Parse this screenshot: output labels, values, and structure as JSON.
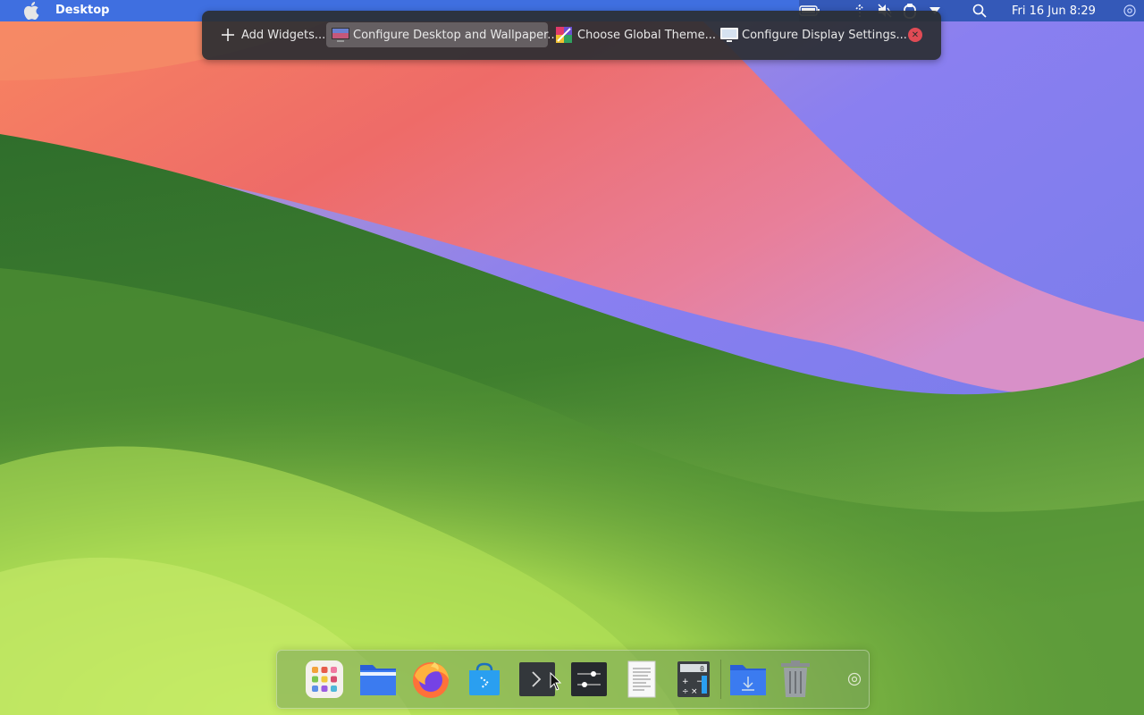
{
  "menubar": {
    "app_name": "Desktop",
    "clock": "Fri 16 Jun 8:29",
    "tray_icons": [
      "battery-icon",
      "network-icon",
      "volume-muted-icon",
      "clipboard-icon",
      "expand-arrow-icon",
      "search-icon",
      "settings-icon"
    ]
  },
  "toolbar": {
    "add_widgets": "Add Widgets...",
    "configure_desktop": "Configure Desktop and Wallpaper...",
    "global_theme": "Choose Global Theme...",
    "display_settings": "Configure Display Settings..."
  },
  "dock": {
    "items": [
      "launchpad",
      "file-manager",
      "firefox",
      "discover-store",
      "terminal",
      "system-settings",
      "text-editor",
      "calculator",
      "downloads",
      "trash",
      "dock-settings"
    ]
  },
  "colors": {
    "menubar": "#3f6fe0",
    "tray": "#3459b8",
    "toolbar_bg": "#2a2e32",
    "close": "#e04b55"
  }
}
